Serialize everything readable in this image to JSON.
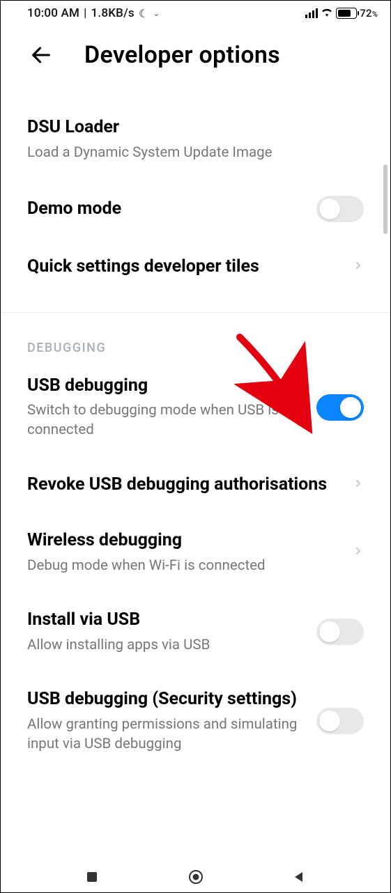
{
  "status": {
    "time": "10:00 AM",
    "net_speed": "1.8KB/s",
    "battery_pct": "72",
    "pct_sym": "%"
  },
  "header": {
    "title": "Developer options"
  },
  "sections": {
    "general": [
      {
        "title": "DSU Loader",
        "sub": "Load a Dynamic System Update Image"
      },
      {
        "title": "Demo mode"
      },
      {
        "title": "Quick settings developer tiles"
      }
    ],
    "debugging_header": "DEBUGGING",
    "debugging": [
      {
        "title": "USB debugging",
        "sub": "Switch to debugging mode when USB is connected"
      },
      {
        "title": "Revoke USB debugging authorisations"
      },
      {
        "title": "Wireless debugging",
        "sub": "Debug mode when Wi-Fi is connected"
      },
      {
        "title": "Install via USB",
        "sub": "Allow installing apps via USB"
      },
      {
        "title": "USB debugging (Security settings)",
        "sub": "Allow granting permissions and simulating input via USB debugging"
      }
    ]
  },
  "toggles": {
    "demo_mode": false,
    "usb_debugging": true,
    "install_via_usb": false,
    "usb_debugging_security": false
  }
}
